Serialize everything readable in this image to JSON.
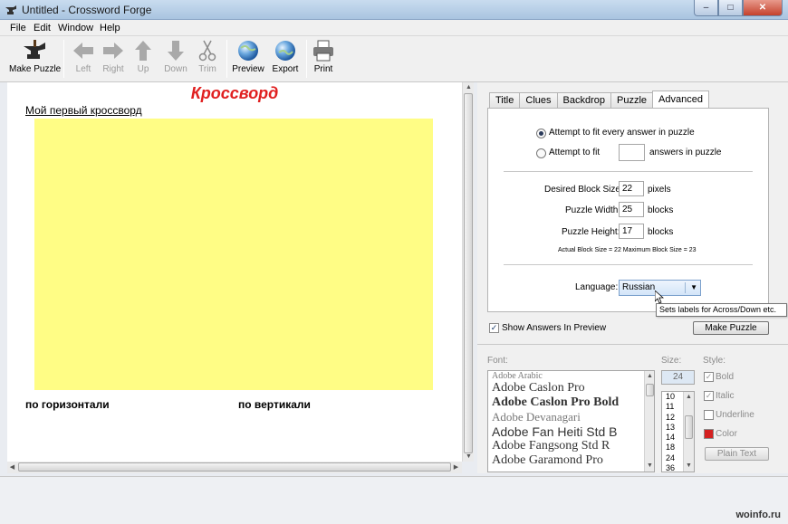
{
  "window": {
    "title": "Untitled - Crossword Forge",
    "min_glyph": "–",
    "max_glyph": "□",
    "close_glyph": "✕"
  },
  "menu": [
    "File",
    "Edit",
    "Window",
    "Help"
  ],
  "toolbar": {
    "make_puzzle": "Make Puzzle",
    "left": "Left",
    "right": "Right",
    "up": "Up",
    "down": "Down",
    "trim": "Trim",
    "preview": "Preview",
    "export": "Export",
    "print": "Print"
  },
  "puzzle": {
    "title": "Кроссворд",
    "subtitle": "Мой первый кроссворд",
    "across_label": "по горизонтали",
    "down_label": "по вертикали",
    "title_color": "#e02020",
    "grid_color": "#fffd85"
  },
  "tabs": [
    "Title",
    "Clues",
    "Backdrop",
    "Puzzle",
    "Advanced"
  ],
  "advanced": {
    "fit_all_label": "Attempt to fit every answer in puzzle",
    "fit_n_label": "Attempt to fit",
    "fit_n_suffix": "answers in puzzle",
    "fit_n_value": "",
    "block_size_label": "Desired Block Size:",
    "block_size_value": "22",
    "block_size_unit": "pixels",
    "width_label": "Puzzle Width:",
    "width_value": "25",
    "width_unit": "blocks",
    "height_label": "Puzzle Height:",
    "height_value": "17",
    "height_unit": "blocks",
    "actual_info": "Actual Block Size = 22    Maximum Block Size = 23",
    "language_label": "Language:",
    "language_value": "Russian",
    "tooltip": "Sets labels for Across/Down etc."
  },
  "show_answers_label": "Show Answers In Preview",
  "make_puzzle_button": "Make Puzzle",
  "font_panel": {
    "font_label": "Font:",
    "size_label": "Size:",
    "style_label": "Style:",
    "fonts": [
      "Adobe Arabic",
      "Adobe Caslon Pro",
      "Adobe Caslon Pro Bold",
      "Adobe Devanagari",
      "Adobe Fan Heiti Std B",
      "Adobe Fangsong Std R",
      "Adobe Garamond Pro"
    ],
    "size_value": "24",
    "sizes": [
      "10",
      "11",
      "12",
      "13",
      "14",
      "18",
      "24",
      "36"
    ],
    "bold": "Bold",
    "italic": "Italic",
    "underline": "Underline",
    "color": "Color",
    "plain_text": "Plain Text"
  },
  "watermark": "woinfo.ru"
}
